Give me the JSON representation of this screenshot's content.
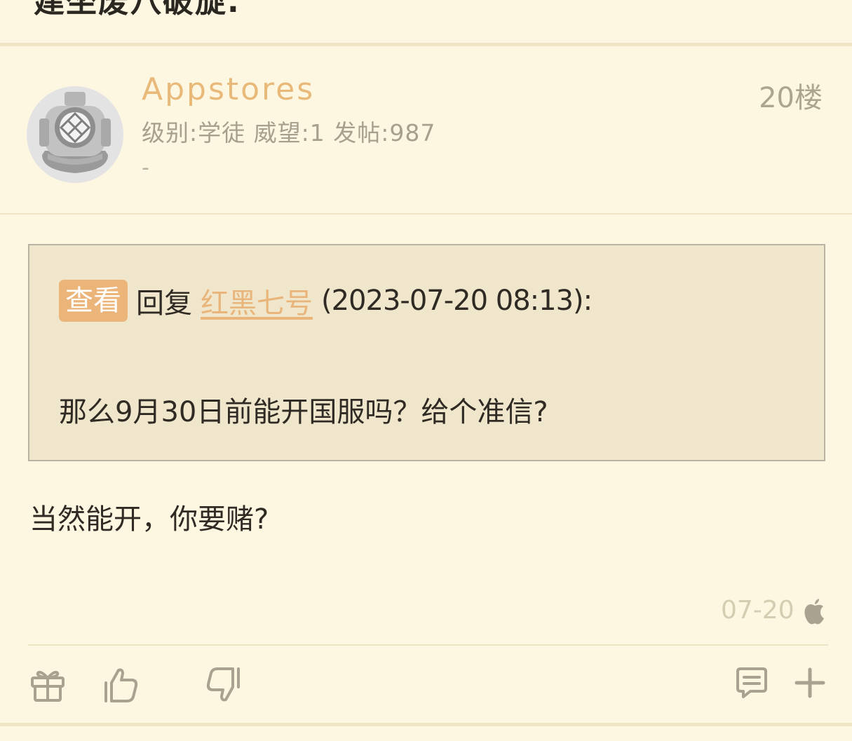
{
  "previous_post": {
    "title_fragment": "建坐废八破旋."
  },
  "post": {
    "author": {
      "name": "Appstores",
      "meta": "级别:学徒 威望:1 发帖:987",
      "signature": "-"
    },
    "floor": "20楼",
    "quote": {
      "view_label": "查看",
      "reply_label": "回复",
      "reply_to_user": "红黑七号",
      "reply_time": "(2023-07-20 08:13):",
      "text": "那么9月30日前能开国服吗？给个准信?"
    },
    "body": "当然能开，你要赌?",
    "date": "07-20",
    "device_icon": "apple-icon"
  },
  "actions": {
    "left": [
      "gift-icon",
      "thumbs-up-icon",
      "thumbs-down-icon"
    ],
    "right": [
      "comment-icon",
      "plus-icon"
    ]
  },
  "colors": {
    "background": "#fdf7e2",
    "accent": "#ebb57a",
    "quote_background": "#efe6cb",
    "muted_text": "#aba48f"
  }
}
